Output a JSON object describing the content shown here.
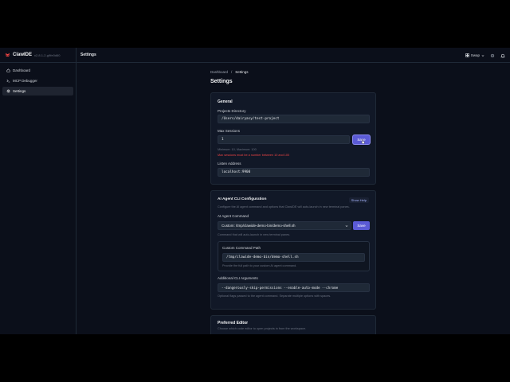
{
  "header": {
    "app_name": "ClawIDE",
    "version": "v2.8.1-2-g9fe0d60",
    "page_label": "Settings",
    "theme_label": "Swap"
  },
  "sidebar": {
    "items": [
      {
        "label": "Dashboard",
        "icon": "home-icon"
      },
      {
        "label": "MCP Debugger",
        "icon": "terminal-icon"
      },
      {
        "label": "Settings",
        "icon": "gear-icon",
        "active": true
      }
    ]
  },
  "breadcrumb": {
    "parent": "Dashboard",
    "separator": "/",
    "current": "Settings"
  },
  "page_title": "Settings",
  "general": {
    "title": "General",
    "projects_dir_label": "Projects Directory",
    "projects_dir_value": "/Users/dairyasy/test-project",
    "max_sessions_label": "Max Sessions",
    "max_sessions_value": "1",
    "save_label": "Save",
    "max_sessions_help": "Minimum: 10, Maximum: 100",
    "max_sessions_error": "Max sessions must be a number between 10 and 100",
    "listen_label": "Listen Address",
    "listen_value": "localhost:9900"
  },
  "ai_agent": {
    "title": "AI Agent CLI Configuration",
    "show_help": "Show Help",
    "description": "Configure the AI agent command and options that ClawIDE will auto-launch in new terminal panes.",
    "command_label": "AI Agent Command",
    "command_value": "Custom: /tmp/clawide-demo-bin/demo-shell.sh",
    "save_label": "Save",
    "command_help": "Command that will auto-launch in new terminal panes.",
    "custom_path_label": "Custom Command Path",
    "custom_path_value": "/tmp/clawide-demo-bin/demo-shell.sh",
    "custom_path_help": "Provide the full path to your custom AI agent command.",
    "args_label": "Additional CLI Arguments",
    "args_value": "--dangerously-skip-permissions --enable-auto-mode --chrome",
    "args_help": "Optional flags passed to the agent command. Separate multiple options with spaces."
  },
  "editor": {
    "title": "Preferred Editor",
    "description": "Choose which code editor to open projects in from the workspace."
  },
  "colors": {
    "accent": "#5b5bd6",
    "error": "#ef4444",
    "background": "#0b0f1a",
    "card": "#111827"
  }
}
